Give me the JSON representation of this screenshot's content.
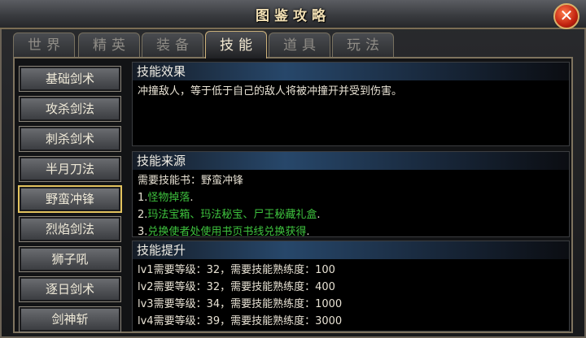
{
  "window": {
    "title": "图鉴攻略"
  },
  "tabs": [
    {
      "label": "世界",
      "active": false
    },
    {
      "label": "精英",
      "active": false
    },
    {
      "label": "装备",
      "active": false
    },
    {
      "label": "技能",
      "active": true
    },
    {
      "label": "道具",
      "active": false
    },
    {
      "label": "玩法",
      "active": false
    }
  ],
  "skills": [
    {
      "label": "基础剑术",
      "active": false
    },
    {
      "label": "攻杀剑法",
      "active": false
    },
    {
      "label": "刺杀剑术",
      "active": false
    },
    {
      "label": "半月刀法",
      "active": false
    },
    {
      "label": "野蛮冲锋",
      "active": true
    },
    {
      "label": "烈焰剑法",
      "active": false
    },
    {
      "label": "狮子吼",
      "active": false
    },
    {
      "label": "逐日剑术",
      "active": false
    },
    {
      "label": "剑神斩",
      "active": false
    }
  ],
  "effect": {
    "heading": "技能效果",
    "text": "冲撞敌人，等于低于自己的敌人将被冲撞开并受到伤害。"
  },
  "source": {
    "heading": "技能来源",
    "book_line": "需要技能书：野蛮冲锋",
    "items": [
      {
        "num": "1.",
        "text": "怪物掉落",
        "end": "."
      },
      {
        "num": "2.",
        "text": "玛法宝箱、玛法秘宝、尸王秘藏礼盒",
        "end": "."
      },
      {
        "num": "3.",
        "text": "兑换使者处使用书页书线兑换获得",
        "end": "."
      }
    ]
  },
  "upgrade": {
    "heading": "技能提升",
    "rows": [
      "lv1需要等级：32，需要技能熟练度：100",
      "lv2需要等级：32，需要技能熟练度：400",
      "lv3需要等级：34，需要技能熟练度：1000",
      "lv4需要等级：39，需要技能熟练度：3000"
    ]
  },
  "colors": {
    "accent_green": "#3ec33e",
    "panel_head_blue": "#27476a",
    "selected_outline": "#e3c35e"
  }
}
